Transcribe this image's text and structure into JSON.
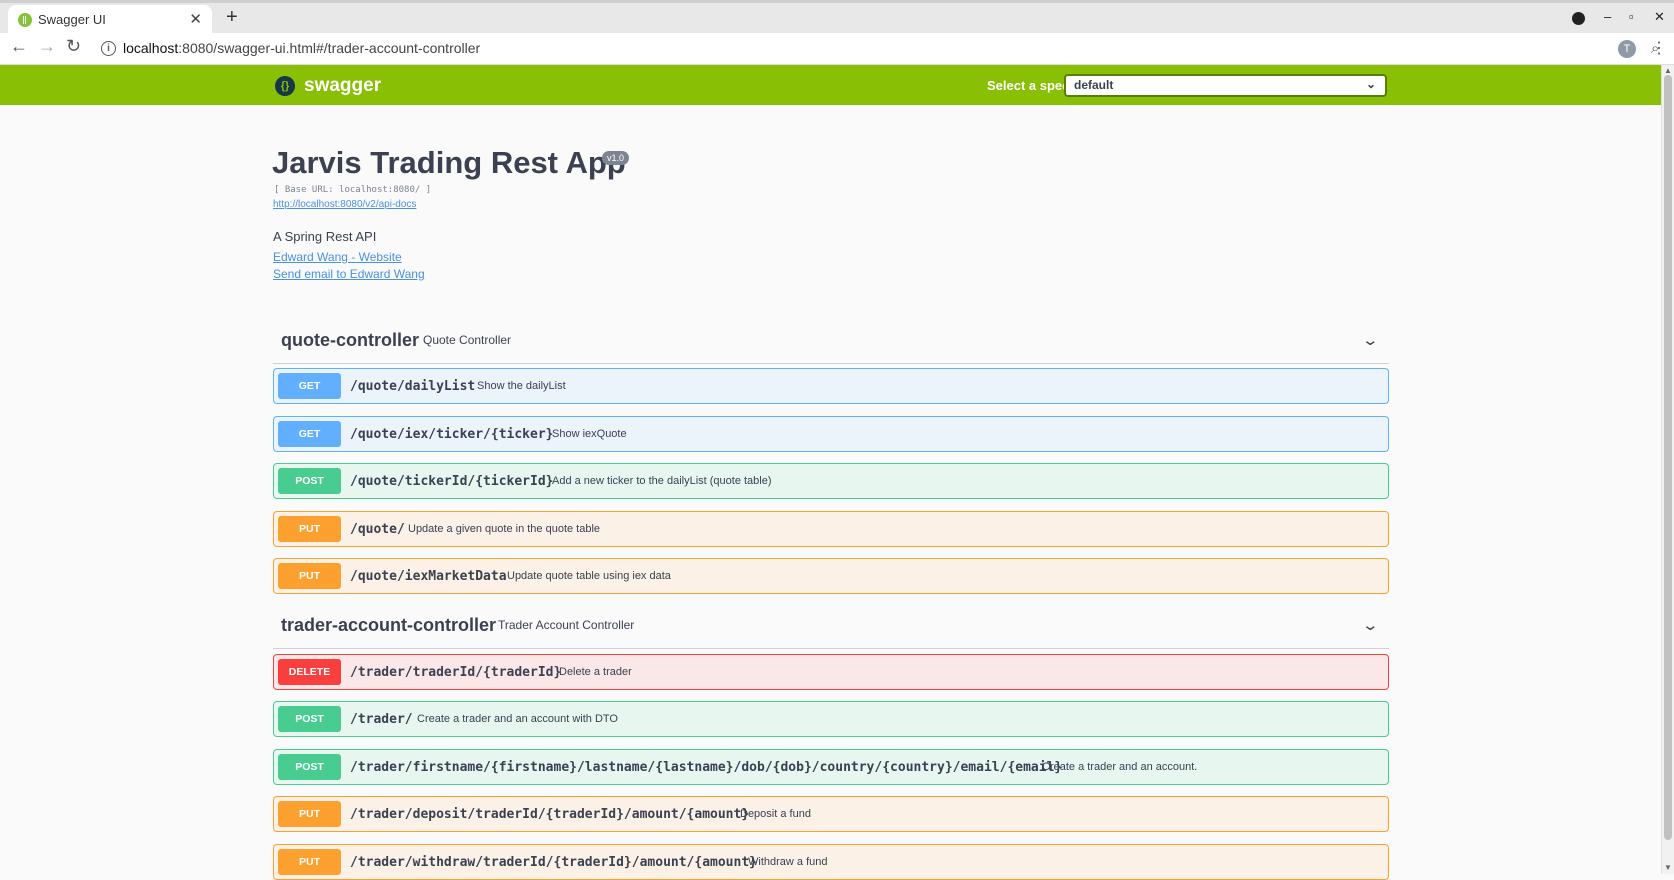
{
  "browser": {
    "tab_title": "Swagger UI",
    "tab_close": "✕",
    "new_tab": "+",
    "win_minimize": "–",
    "win_maximize": "▫",
    "win_close": "✕",
    "back": "←",
    "forward": "→",
    "reload": "↻",
    "url_host": "localhost",
    "url_rest": ":8080/swagger-ui.html#/trader-account-controller",
    "avatar_letter": "T",
    "icons": {
      "favicon": "swagger-favicon",
      "info": "info-icon",
      "zoom": "zoom-icon",
      "star": "star-icon",
      "menu": "menu-icon"
    }
  },
  "topbar": {
    "brand": "swagger",
    "select_label": "Select a spec",
    "select_value": "default",
    "color": "#89bf04"
  },
  "info": {
    "title": "Jarvis Trading Rest App",
    "version": "v1.0",
    "base_url": "[ Base URL: localhost:8080/ ]",
    "api_docs_url": "http://localhost:8080/v2/api-docs",
    "description": "A Spring Rest API",
    "website_link": "Edward Wang - Website",
    "email_link": "Send email to Edward Wang"
  },
  "sections": [
    {
      "name": "quote-controller",
      "description": "Quote Controller",
      "operations": [
        {
          "method": "GET",
          "path": "/quote/dailyList",
          "summary": "Show the dailyList"
        },
        {
          "method": "GET",
          "path": "/quote/iex/ticker/{ticker}",
          "summary": "Show iexQuote"
        },
        {
          "method": "POST",
          "path": "/quote/tickerId/{tickerId}",
          "summary": "Add a new ticker to the dailyList (quote table)"
        },
        {
          "method": "PUT",
          "path": "/quote/",
          "summary": "Update a given quote in the quote table"
        },
        {
          "method": "PUT",
          "path": "/quote/iexMarketData",
          "summary": "Update quote table using iex data"
        }
      ]
    },
    {
      "name": "trader-account-controller",
      "description": "Trader Account Controller",
      "operations": [
        {
          "method": "DELETE",
          "path": "/trader/traderId/{traderId}",
          "summary": "Delete a trader"
        },
        {
          "method": "POST",
          "path": "/trader/",
          "summary": "Create a trader and an account with DTO"
        },
        {
          "method": "POST",
          "path": "/trader/firstname/{firstname}/lastname/{lastname}/dob/{dob}/country/{country}/email/{email}",
          "summary": "Create a trader and an account."
        },
        {
          "method": "PUT",
          "path": "/trader/deposit/traderId/{traderId}/amount/{amount}",
          "summary": "Deposit a fund"
        },
        {
          "method": "PUT",
          "path": "/trader/withdraw/traderId/{traderId}/amount/{amount}",
          "summary": "Withdraw a fund"
        }
      ]
    }
  ],
  "method_colors": {
    "GET": "#61affe",
    "POST": "#49cc90",
    "PUT": "#fca130",
    "DELETE": "#f93e3e"
  }
}
